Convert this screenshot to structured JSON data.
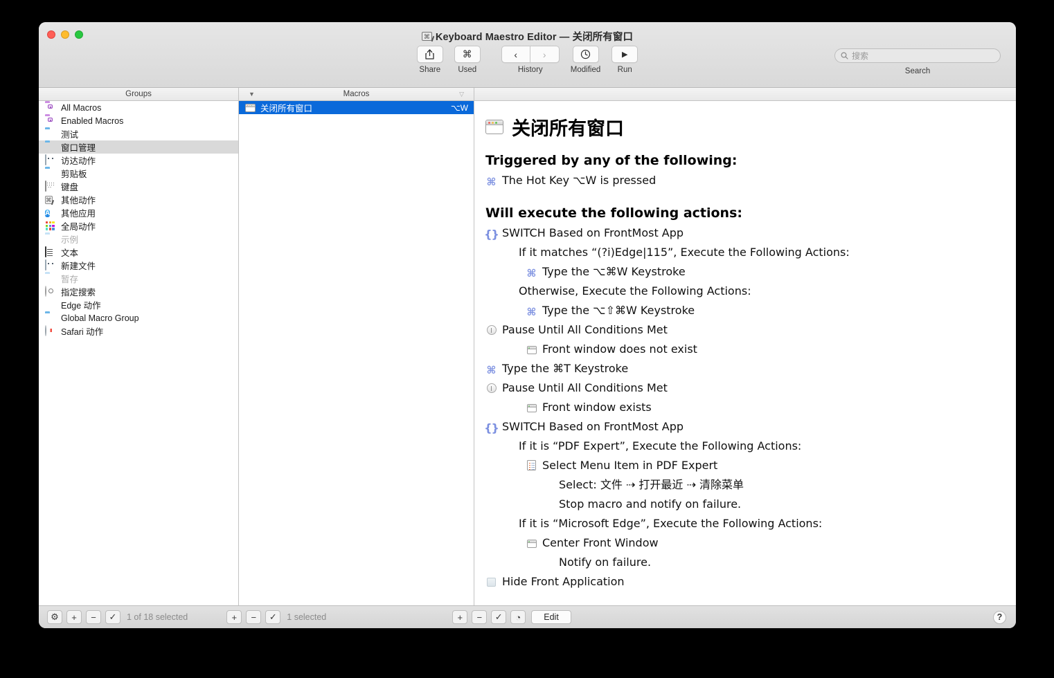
{
  "window": {
    "title": "Keyboard Maestro Editor — 关闭所有窗口",
    "app_badge_icon": "command-badge-icon"
  },
  "toolbar": {
    "share": {
      "label": "Share",
      "icon": "share-icon"
    },
    "used": {
      "label": "Used",
      "icon": "command-icon",
      "glyph": "⌘"
    },
    "history": {
      "label": "History",
      "back_icon": "chevron-left-icon",
      "forward_icon": "chevron-right-icon",
      "back_glyph": "‹",
      "forward_glyph": "›"
    },
    "modified": {
      "label": "Modified",
      "icon": "clock-icon"
    },
    "run": {
      "label": "Run",
      "icon": "play-icon",
      "glyph": "▶"
    }
  },
  "search": {
    "placeholder": "搜索",
    "value": "",
    "sublabel": "Search",
    "icon": "search-icon"
  },
  "columns": {
    "groups": "Groups",
    "macros": "Macros",
    "sort_desc_glyph": "▼",
    "sort_asc_glyph": "▽"
  },
  "groups": {
    "items": [
      {
        "label": "All Macros",
        "icon": "purple-folder-icon",
        "selected": false,
        "dimmed": false
      },
      {
        "label": "Enabled Macros",
        "icon": "purple-folder-icon",
        "selected": false,
        "dimmed": false
      },
      {
        "label": "测试",
        "icon": "blue-folder-icon",
        "selected": false,
        "dimmed": false
      },
      {
        "label": "窗口管理",
        "icon": "blue-folder-icon",
        "selected": true,
        "dimmed": false
      },
      {
        "label": "访达动作",
        "icon": "finder-icon",
        "selected": false,
        "dimmed": false
      },
      {
        "label": "剪贴板",
        "icon": "blue-folder-icon",
        "selected": false,
        "dimmed": false
      },
      {
        "label": "键盘",
        "icon": "keyboard-icon",
        "selected": false,
        "dimmed": false
      },
      {
        "label": "其他动作",
        "icon": "keyboard-maestro-icon",
        "selected": false,
        "dimmed": false
      },
      {
        "label": "其他应用",
        "icon": "app-store-icon",
        "selected": false,
        "dimmed": false
      },
      {
        "label": "全局动作",
        "icon": "color-grid-icon",
        "selected": false,
        "dimmed": false
      },
      {
        "label": "示例",
        "icon": "pale-folder-icon",
        "selected": false,
        "dimmed": true
      },
      {
        "label": "文本",
        "icon": "text-document-icon",
        "selected": false,
        "dimmed": false
      },
      {
        "label": "新建文件",
        "icon": "finder-icon",
        "selected": false,
        "dimmed": false
      },
      {
        "label": "暂存",
        "icon": "pale-folder-icon",
        "selected": false,
        "dimmed": true
      },
      {
        "label": "指定搜索",
        "icon": "gray-magnifier-icon",
        "selected": false,
        "dimmed": false
      },
      {
        "label": "Edge 动作",
        "icon": "edge-browser-icon",
        "selected": false,
        "dimmed": false
      },
      {
        "label": "Global Macro Group",
        "icon": "blue-folder-icon",
        "selected": false,
        "dimmed": false
      },
      {
        "label": "Safari 动作",
        "icon": "safari-browser-icon",
        "selected": false,
        "dimmed": false
      }
    ]
  },
  "macros": {
    "items": [
      {
        "name": "关闭所有窗口",
        "hotkey": "⌥W",
        "icon": "window-icon",
        "selected": true
      }
    ]
  },
  "detail": {
    "title": "关闭所有窗口",
    "title_icon": "window-icon",
    "trigger_heading": "Triggered by any of the following:",
    "triggers": [
      {
        "text": "The Hot Key ⌥W is pressed",
        "icon": "command-icon",
        "indent": 0
      }
    ],
    "actions_heading": "Will execute the following actions:",
    "actions": [
      {
        "text": "SWITCH Based on FrontMost App",
        "icon": "switch-braces-icon",
        "indent": 0
      },
      {
        "text": "If it matches “(?i)Edge|115”, Execute the Following Actions:",
        "icon": "none",
        "indent": 1
      },
      {
        "text": "Type the ⌥⌘W Keystroke",
        "icon": "command-icon",
        "indent": 2
      },
      {
        "text": "Otherwise, Execute the Following Actions:",
        "icon": "none",
        "indent": 1
      },
      {
        "text": "Type the ⌥⇧⌘W Keystroke",
        "icon": "command-icon",
        "indent": 2
      },
      {
        "text": "Pause Until All Conditions Met",
        "icon": "pause-icon",
        "indent": 0
      },
      {
        "text": "Front window does not exist",
        "icon": "window-small-icon",
        "indent": 2
      },
      {
        "text": "Type the ⌘T Keystroke",
        "icon": "command-icon",
        "indent": 0
      },
      {
        "text": "Pause Until All Conditions Met",
        "icon": "pause-icon",
        "indent": 0
      },
      {
        "text": "Front window exists",
        "icon": "window-small-icon",
        "indent": 2
      },
      {
        "text": "SWITCH Based on FrontMost App",
        "icon": "switch-braces-icon",
        "indent": 0
      },
      {
        "text": "If it is “PDF Expert”, Execute the Following Actions:",
        "icon": "none",
        "indent": 1
      },
      {
        "text": "Select Menu Item in PDF Expert",
        "icon": "menu-list-icon",
        "indent": 2
      },
      {
        "text": "Select: 文件 ⇢ 打开最近 ⇢ 清除菜单",
        "icon": "none",
        "indent": 3
      },
      {
        "text": "Stop macro and notify on failure.",
        "icon": "none",
        "indent": 3
      },
      {
        "text": "If it is “Microsoft Edge”, Execute the Following Actions:",
        "icon": "none",
        "indent": 1
      },
      {
        "text": "Center Front Window",
        "icon": "window-small-icon",
        "indent": 2
      },
      {
        "text": "Notify on failure.",
        "icon": "none",
        "indent": 3
      },
      {
        "text": "Hide Front Application",
        "icon": "hide-app-icon",
        "indent": 0
      }
    ]
  },
  "statusbar": {
    "groups_controls": [
      {
        "icon": "gear-icon",
        "glyph": "⚙"
      },
      {
        "icon": "plus-icon",
        "glyph": "+"
      },
      {
        "icon": "minus-icon",
        "glyph": "−"
      },
      {
        "icon": "check-icon",
        "glyph": "✓"
      }
    ],
    "groups_status": "1 of 18 selected",
    "macros_controls": [
      {
        "icon": "plus-icon",
        "glyph": "+"
      },
      {
        "icon": "minus-icon",
        "glyph": "−"
      },
      {
        "icon": "check-icon",
        "glyph": "✓"
      }
    ],
    "macros_status": "1 selected",
    "actions_controls": [
      {
        "icon": "plus-icon",
        "glyph": "+"
      },
      {
        "icon": "minus-icon",
        "glyph": "−"
      },
      {
        "icon": "check-icon",
        "glyph": "✓"
      },
      {
        "icon": "clock-icon",
        "glyph": "◔"
      }
    ],
    "edit_label": "Edit",
    "help_label": "?"
  },
  "colors": {
    "selection_blue": "#0a69da",
    "selection_gray": "#d9d9d9",
    "action_icon_blue": "#7b8fe0",
    "window_bg": "#ececec"
  }
}
